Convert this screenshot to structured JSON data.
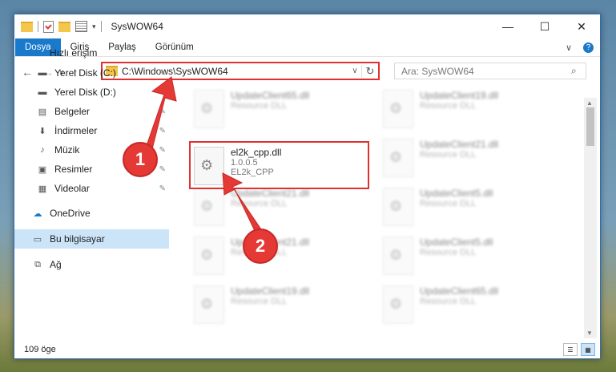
{
  "window": {
    "title": "SysWOW64"
  },
  "caption_buttons": {
    "minimize": "—",
    "maximize": "☐",
    "close": "✕"
  },
  "ribbon": {
    "tabs": [
      "Dosya",
      "Giriş",
      "Paylaş",
      "Görünüm"
    ],
    "collapse": "∨",
    "help": "?"
  },
  "address": {
    "path": "C:\\Windows\\SysWOW64",
    "dropdown": "∨",
    "refresh": "↻"
  },
  "search": {
    "placeholder": "Ara: SysWOW64",
    "icon": "⌕"
  },
  "nav_buttons": {
    "back": "←",
    "forward": "→",
    "recent": "∨",
    "up": "↑"
  },
  "sidebar": {
    "items": [
      {
        "label": "Hızlı erişim",
        "icon": "★"
      },
      {
        "label": "Yerel Disk (C:)",
        "icon": "▬",
        "pinned": true
      },
      {
        "label": "Yerel Disk (D:)",
        "icon": "▬",
        "pinned": true
      },
      {
        "label": "Belgeler",
        "icon": "▤",
        "pinned": true
      },
      {
        "label": "İndirmeler",
        "icon": "⬇",
        "pinned": true
      },
      {
        "label": "Müzik",
        "icon": "♪",
        "pinned": true
      },
      {
        "label": "Resimler",
        "icon": "▣",
        "pinned": true
      },
      {
        "label": "Videolar",
        "icon": "▦",
        "pinned": true
      },
      {
        "label": "OneDrive",
        "icon": "☁"
      },
      {
        "label": "Bu bilgisayar",
        "icon": "▭",
        "selected": true
      },
      {
        "label": "Ağ",
        "icon": "⧉"
      }
    ],
    "pin_glyph": "📌"
  },
  "files": {
    "highlighted": {
      "name": "el2k_cpp.dll",
      "version": "1.0.0.5",
      "description": "EL2k_CPP"
    },
    "blurred": [
      {
        "name": "UpdateClient65.dll",
        "sub": "Resource DLL"
      },
      {
        "name": "UpdateClient19.dll",
        "sub": "Resource DLL"
      },
      {
        "name": "UpdateClient21.dll",
        "sub": "Resource DLL"
      },
      {
        "name": "UpdateClient21.dll",
        "sub": "Resource DLL"
      },
      {
        "name": "UpdateClient5.dll",
        "sub": "Resource DLL"
      },
      {
        "name": "UpdateClient21.dll",
        "sub": "Resource DLL"
      },
      {
        "name": "UpdateClient5.dll",
        "sub": "Resource DLL"
      },
      {
        "name": "UpdateClient19.dll",
        "sub": "Resource DLL"
      },
      {
        "name": "UpdateClient65.dll",
        "sub": "Resource DLL"
      }
    ]
  },
  "status": {
    "count": "109 öge"
  },
  "annotations": {
    "badge1": "1",
    "badge2": "2"
  },
  "colors": {
    "accent": "#1979ca",
    "highlight": "#e03030"
  }
}
